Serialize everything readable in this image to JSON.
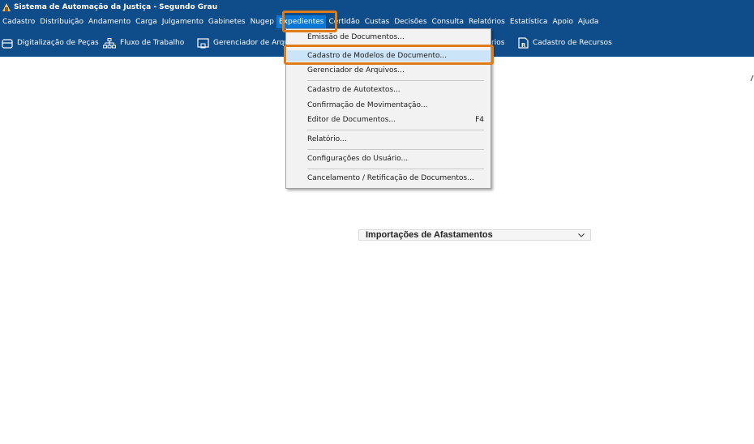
{
  "app": {
    "title": "Sistema de Automação da Justiça - Segundo Grau"
  },
  "menubar": {
    "items": [
      "Cadastro",
      "Distribuição",
      "Andamento",
      "Carga",
      "Julgamento",
      "Gabinetes",
      "Nugep",
      "Expedientes",
      "Certidão",
      "Custas",
      "Decisões",
      "Consulta",
      "Relatórios",
      "Estatística",
      "Apoio",
      "Ajuda"
    ],
    "active": "Expedientes"
  },
  "toolbar": {
    "digitalizacao": "Digitalização de Peças",
    "fluxo": "Fluxo de Trabalho",
    "gerenciador": "Gerenciador de Arqu",
    "hidden_partial": "rios",
    "cadastro_recursos": "Cadastro de Recursos"
  },
  "dropdown": {
    "emissao": "Emissão de Documentos...",
    "cadastro_modelos": "Cadastro de Modelos de Documento...",
    "gerenciador_arquivos": "Gerenciador de Arquivos...",
    "cadastro_autotextos": "Cadastro de Autotextos...",
    "confirmacao": "Confirmação de Movimentação...",
    "editor": "Editor de Documentos...",
    "editor_shortcut": "F4",
    "relatorio": "Relatório...",
    "configuracoes": "Configurações do Usuário...",
    "cancelamento": "Cancelamento / Retificação de Documentos..."
  },
  "combo": {
    "value": "Importações de Afastamentos"
  },
  "colors": {
    "chrome": "#0f4c8a",
    "highlight": "#e07b1a",
    "selected_item": "#cce4f7"
  }
}
